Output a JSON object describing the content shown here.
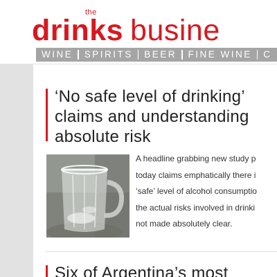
{
  "logo": {
    "small": "the",
    "word1": "drinks",
    "word2": "busine"
  },
  "nav": {
    "items": [
      "WINE",
      "SPIRITS",
      "BEER",
      "FINE WINE",
      "C"
    ]
  },
  "articles": [
    {
      "title_lines": [
        "‘No safe level of drinking’",
        "claims and understanding",
        "absolute risk"
      ],
      "excerpt_lines": [
        "A headline grabbing new study p",
        "today claims emphatically there i",
        "‘safe’ level of alcohol consumptio",
        "the actual risks involved in drinki",
        "not made absolutely clear."
      ],
      "thumbnail_icon": "beer-glass-photo"
    },
    {
      "title_lines": [
        "Six of Argentina’s most"
      ]
    }
  ],
  "colors": {
    "brand_red": "#d8181f",
    "nav_grey": "#a5a5a5",
    "panel_grey": "#e2e2e2"
  }
}
